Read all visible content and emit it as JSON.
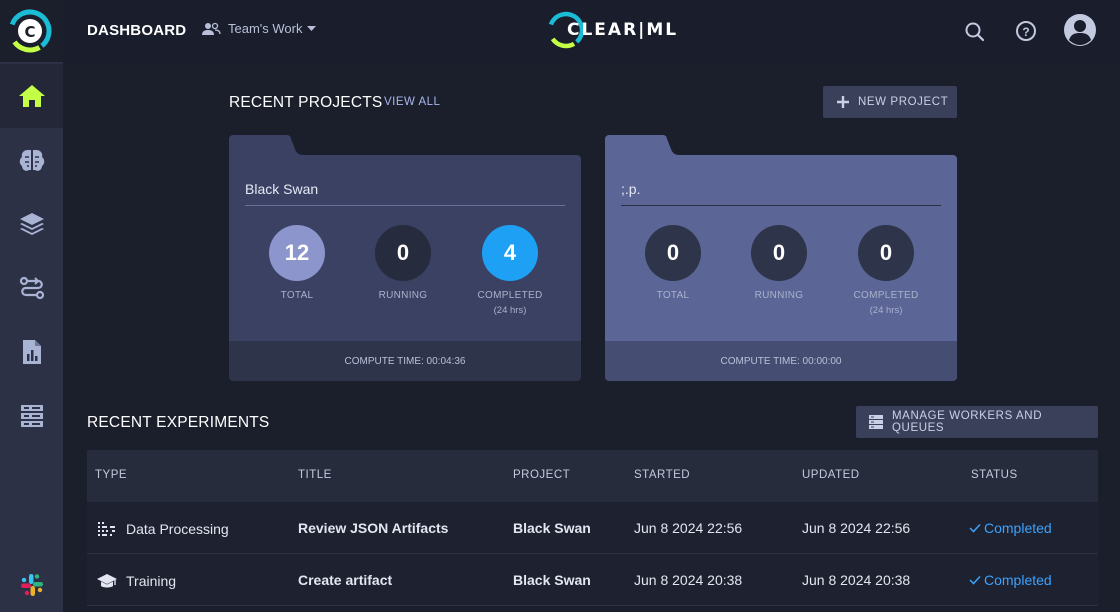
{
  "header": {
    "title": "DASHBOARD",
    "workspace": "Team's Work",
    "brand": "CLEAR|ML"
  },
  "sidebar": {
    "items": [
      {
        "icon": "home-icon",
        "active": true
      },
      {
        "icon": "brain-icon",
        "active": false
      },
      {
        "icon": "layers-icon",
        "active": false
      },
      {
        "icon": "pipelines-icon",
        "active": false
      },
      {
        "icon": "reports-icon",
        "active": false
      },
      {
        "icon": "workers-icon",
        "active": false
      }
    ],
    "bottom_icon": "slack-icon"
  },
  "projects": {
    "title": "RECENT PROJECTS",
    "view_all": "VIEW ALL",
    "new_project": "NEW PROJECT",
    "cards": [
      {
        "name": "Black Swan",
        "total": "12",
        "running": "0",
        "completed": "4",
        "total_label": "TOTAL",
        "running_label": "RUNNING",
        "completed_label": "COMPLETED",
        "completed_sub": "(24 hrs)",
        "compute_time": "COMPUTE TIME: 00:04:36"
      },
      {
        "name": ";.p.",
        "total": "0",
        "running": "0",
        "completed": "0",
        "total_label": "TOTAL",
        "running_label": "RUNNING",
        "completed_label": "COMPLETED",
        "completed_sub": "(24 hrs)",
        "compute_time": "COMPUTE TIME: 00:00:00"
      }
    ]
  },
  "experiments": {
    "title": "RECENT EXPERIMENTS",
    "manage_button": "MANAGE WORKERS AND QUEUES",
    "columns": [
      "TYPE",
      "TITLE",
      "PROJECT",
      "STARTED",
      "UPDATED",
      "STATUS"
    ],
    "rows": [
      {
        "type": "Data Processing",
        "type_icon": "data-processing-icon",
        "title": "Review JSON Artifacts",
        "project": "Black Swan",
        "started": "Jun 8 2024 22:56",
        "updated": "Jun 8 2024 22:56",
        "status": "Completed"
      },
      {
        "type": "Training",
        "type_icon": "training-icon",
        "title": "Create artifact",
        "project": "Black Swan",
        "started": "Jun 8 2024 20:38",
        "updated": "Jun 8 2024 20:38",
        "status": "Completed"
      }
    ]
  },
  "colors": {
    "accent_green": "#c4ff47",
    "completed_blue": "#1ea0f5",
    "total_circle": "#8c95cc",
    "card1_bg": "#3a4162",
    "card2_bg": "#5b6596"
  }
}
